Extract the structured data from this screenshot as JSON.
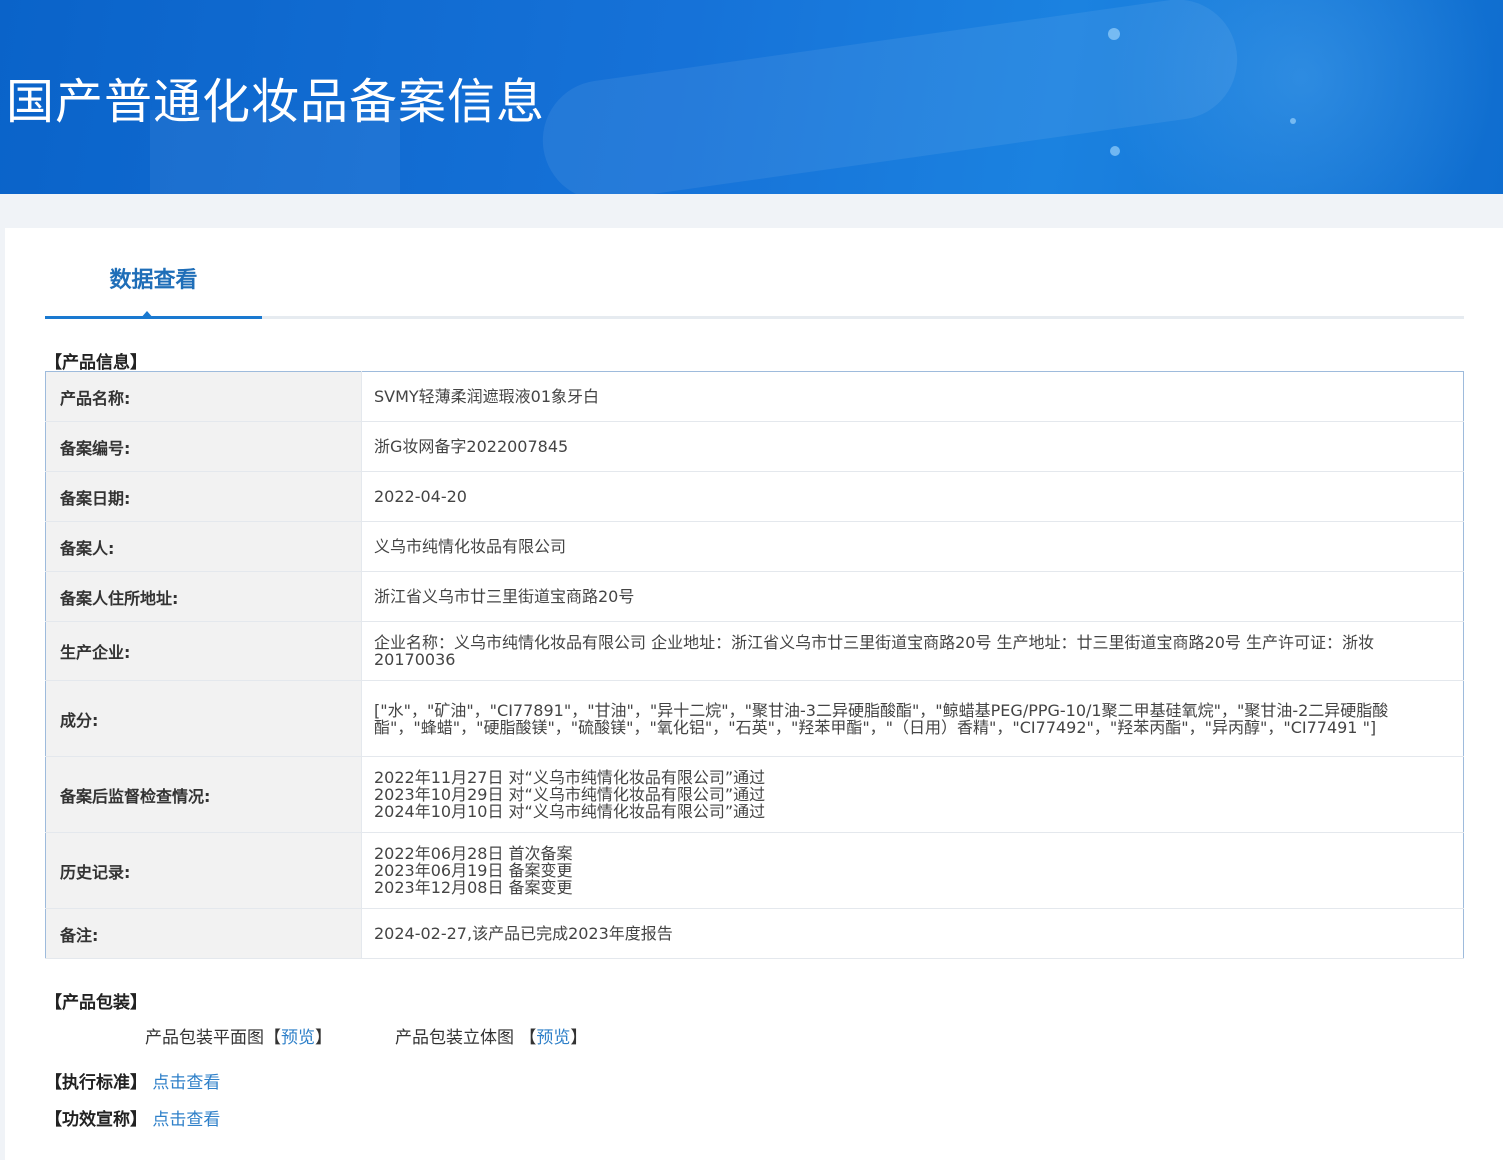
{
  "header": {
    "title": "国产普通化妆品备案信息"
  },
  "tabs": [
    {
      "label": "数据查看"
    }
  ],
  "product_info": {
    "section_title": "【产品信息】",
    "rows": [
      {
        "label": "产品名称:",
        "value": "SVMY轻薄柔润遮瑕液01象牙白"
      },
      {
        "label": "备案编号:",
        "value": "浙G妆网备字2022007845"
      },
      {
        "label": "备案日期:",
        "value": "2022-04-20"
      },
      {
        "label": "备案人:",
        "value": "义乌市纯情化妆品有限公司"
      },
      {
        "label": "备案人住所地址:",
        "value": "浙江省义乌市廿三里街道宝商路20号"
      },
      {
        "label": "生产企业:",
        "value": "企业名称：义乌市纯情化妆品有限公司 企业地址：浙江省义乌市廿三里街道宝商路20号 生产地址：廿三里街道宝商路20号 生产许可证：浙妆20170036"
      },
      {
        "label": "成分:",
        "value": "[\"水\"，\"矿油\"，\"CI77891\"，\"甘油\"，\"异十二烷\"，\"聚甘油-3二异硬脂酸酯\"，\"鲸蜡基PEG/PPG-10/1聚二甲基硅氧烷\"，\"聚甘油-2二异硬脂酸酯\"，\"蜂蜡\"，\"硬脂酸镁\"，\"硫酸镁\"，\"氧化铝\"，\"石英\"，\"羟苯甲酯\"，\"（日用）香精\"，\"CI77492\"，\"羟苯丙酯\"，\"异丙醇\"，\"CI77491 \"]"
      },
      {
        "label": "备案后监督检查情况:",
        "lines": [
          "2022年11月27日 对“义乌市纯情化妆品有限公司”通过",
          "2023年10月29日 对“义乌市纯情化妆品有限公司”通过",
          "2024年10月10日 对“义乌市纯情化妆品有限公司”通过"
        ]
      },
      {
        "label": "历史记录:",
        "lines": [
          "2022年06月28日 首次备案",
          "2023年06月19日 备案变更",
          "2023年12月08日 备案变更"
        ]
      },
      {
        "label": "备注:",
        "value": "2024-02-27,该产品已完成2023年度报告"
      }
    ]
  },
  "packaging": {
    "section_title": "【产品包装】",
    "flat_label": "产品包装平面图",
    "flat_link": "预览",
    "solid_label": "产品包装立体图 ",
    "solid_link": "预览",
    "bracket_open": "【",
    "bracket_close": "】"
  },
  "standard": {
    "label": "【执行标准】",
    "link": "点击查看"
  },
  "efficacy": {
    "label": "【功效宣称】",
    "link": "点击查看"
  }
}
